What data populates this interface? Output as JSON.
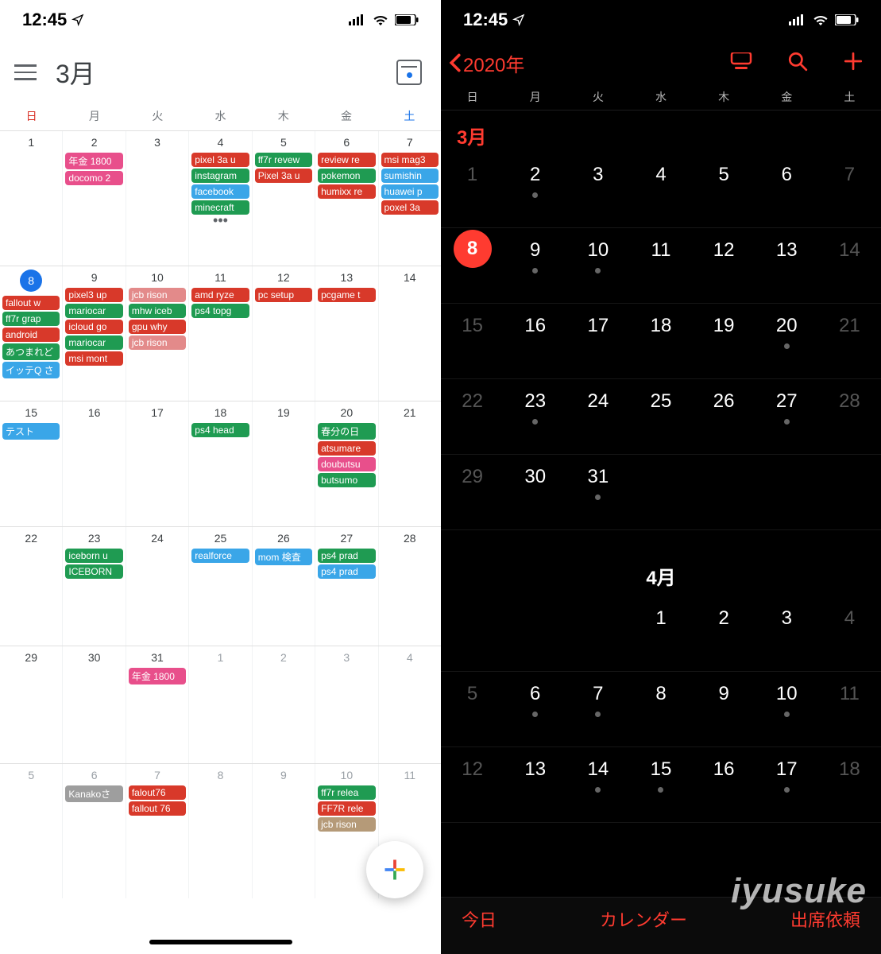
{
  "status": {
    "time": "12:45"
  },
  "google_calendar": {
    "title": "3月",
    "weekdays": [
      "日",
      "月",
      "火",
      "水",
      "木",
      "金",
      "土"
    ],
    "rows": [
      [
        {
          "n": "1",
          "today": false,
          "out": false,
          "events": []
        },
        {
          "n": "2",
          "events": [
            {
              "t": "年金 1800",
              "c": "c-pink"
            },
            {
              "t": "docomo 2",
              "c": "c-pink"
            }
          ]
        },
        {
          "n": "3",
          "events": []
        },
        {
          "n": "4",
          "events": [
            {
              "t": "pixel 3a u",
              "c": "c-red"
            },
            {
              "t": "instagram",
              "c": "c-green"
            },
            {
              "t": "facebook",
              "c": "c-blue"
            },
            {
              "t": "minecraft",
              "c": "c-green"
            }
          ],
          "more": true
        },
        {
          "n": "5",
          "events": [
            {
              "t": "ff7r revew",
              "c": "c-green"
            },
            {
              "t": "Pixel 3a u",
              "c": "c-red"
            }
          ]
        },
        {
          "n": "6",
          "events": [
            {
              "t": "review re",
              "c": "c-red"
            },
            {
              "t": "pokemon",
              "c": "c-green"
            },
            {
              "t": "humixx re",
              "c": "c-red"
            }
          ]
        },
        {
          "n": "7",
          "events": [
            {
              "t": "msi mag3",
              "c": "c-red"
            },
            {
              "t": "sumishin",
              "c": "c-blue"
            },
            {
              "t": "huawei p",
              "c": "c-blue"
            },
            {
              "t": "poxel 3a",
              "c": "c-red"
            }
          ]
        }
      ],
      [
        {
          "n": "8",
          "today": true,
          "events": [
            {
              "t": "fallout w",
              "c": "c-red"
            },
            {
              "t": "ff7r grap",
              "c": "c-green"
            },
            {
              "t": "android",
              "c": "c-red"
            },
            {
              "t": "あつまれど",
              "c": "c-green"
            },
            {
              "t": "イッテQ さ",
              "c": "c-blue"
            }
          ]
        },
        {
          "n": "9",
          "events": [
            {
              "t": "pixel3 up",
              "c": "c-red"
            },
            {
              "t": "mariocar",
              "c": "c-green"
            },
            {
              "t": "icloud go",
              "c": "c-red"
            },
            {
              "t": "mariocar",
              "c": "c-green"
            },
            {
              "t": "msi mont",
              "c": "c-red"
            }
          ]
        },
        {
          "n": "10",
          "events": [
            {
              "t": "jcb rison",
              "c": "c-rose"
            },
            {
              "t": "mhw iceb",
              "c": "c-green"
            },
            {
              "t": "gpu why",
              "c": "c-red"
            },
            {
              "t": "jcb rison",
              "c": "c-rose"
            }
          ]
        },
        {
          "n": "11",
          "events": [
            {
              "t": "amd ryze",
              "c": "c-red"
            },
            {
              "t": "ps4 topg",
              "c": "c-green"
            }
          ]
        },
        {
          "n": "12",
          "events": [
            {
              "t": "pc setup",
              "c": "c-red"
            }
          ]
        },
        {
          "n": "13",
          "events": [
            {
              "t": "pcgame t",
              "c": "c-red"
            }
          ]
        },
        {
          "n": "14",
          "events": []
        }
      ],
      [
        {
          "n": "15",
          "events": [
            {
              "t": "テスト",
              "c": "c-blue"
            }
          ]
        },
        {
          "n": "16",
          "events": []
        },
        {
          "n": "17",
          "events": []
        },
        {
          "n": "18",
          "events": [
            {
              "t": "ps4 head",
              "c": "c-green"
            }
          ]
        },
        {
          "n": "19",
          "events": []
        },
        {
          "n": "20",
          "events": [
            {
              "t": "春分の日",
              "c": "c-green"
            },
            {
              "t": "atsumare",
              "c": "c-red"
            },
            {
              "t": "doubutsu",
              "c": "c-pink"
            },
            {
              "t": "butsumo",
              "c": "c-green"
            }
          ]
        },
        {
          "n": "21",
          "events": []
        }
      ],
      [
        {
          "n": "22",
          "events": []
        },
        {
          "n": "23",
          "events": [
            {
              "t": "iceborn u",
              "c": "c-green"
            },
            {
              "t": "ICEBORN",
              "c": "c-green"
            }
          ]
        },
        {
          "n": "24",
          "events": []
        },
        {
          "n": "25",
          "events": [
            {
              "t": "realforce",
              "c": "c-blue"
            }
          ]
        },
        {
          "n": "26",
          "events": [
            {
              "t": "mom 検査",
              "c": "c-blue"
            }
          ]
        },
        {
          "n": "27",
          "events": [
            {
              "t": "ps4 prad",
              "c": "c-green"
            },
            {
              "t": "ps4 prad",
              "c": "c-blue"
            }
          ]
        },
        {
          "n": "28",
          "events": []
        }
      ],
      [
        {
          "n": "29",
          "events": []
        },
        {
          "n": "30",
          "events": []
        },
        {
          "n": "31",
          "events": [
            {
              "t": "年金 1800",
              "c": "c-pink"
            }
          ]
        },
        {
          "n": "1",
          "out": true,
          "events": []
        },
        {
          "n": "2",
          "out": true,
          "events": []
        },
        {
          "n": "3",
          "out": true,
          "events": []
        },
        {
          "n": "4",
          "out": true,
          "events": []
        }
      ],
      [
        {
          "n": "5",
          "out": true,
          "events": []
        },
        {
          "n": "6",
          "out": true,
          "events": [
            {
              "t": "Kanakoさ",
              "c": "c-grey"
            }
          ]
        },
        {
          "n": "7",
          "out": true,
          "events": [
            {
              "t": "falout76",
              "c": "c-red"
            },
            {
              "t": "fallout 76",
              "c": "c-red"
            }
          ]
        },
        {
          "n": "8",
          "out": true,
          "events": []
        },
        {
          "n": "9",
          "out": true,
          "events": []
        },
        {
          "n": "10",
          "out": true,
          "events": [
            {
              "t": "ff7r relea",
              "c": "c-green"
            },
            {
              "t": "FF7R rele",
              "c": "c-red"
            },
            {
              "t": "jcb rison",
              "c": "c-tan"
            }
          ]
        },
        {
          "n": "11",
          "out": true,
          "events": []
        }
      ]
    ]
  },
  "ios_calendar": {
    "back_label": "2020年",
    "weekdays": [
      "日",
      "月",
      "火",
      "水",
      "木",
      "金",
      "土"
    ],
    "month_mar": "3月",
    "month_apr": "4月",
    "tab_today": "今日",
    "tab_calendars": "カレンダー",
    "tab_inbox": "出席依頼",
    "rows_mar": [
      [
        {
          "n": "1",
          "dim": true
        },
        {
          "n": "2",
          "dot": true
        },
        {
          "n": "3"
        },
        {
          "n": "4"
        },
        {
          "n": "5"
        },
        {
          "n": "6"
        },
        {
          "n": "7",
          "dim": true
        }
      ],
      [
        {
          "n": "8",
          "sel": true
        },
        {
          "n": "9",
          "dot": true
        },
        {
          "n": "10",
          "dot": true
        },
        {
          "n": "11"
        },
        {
          "n": "12"
        },
        {
          "n": "13"
        },
        {
          "n": "14",
          "dim": true
        }
      ],
      [
        {
          "n": "15",
          "dim": true
        },
        {
          "n": "16"
        },
        {
          "n": "17"
        },
        {
          "n": "18"
        },
        {
          "n": "19"
        },
        {
          "n": "20",
          "dot": true
        },
        {
          "n": "21",
          "dim": true
        }
      ],
      [
        {
          "n": "22",
          "dim": true
        },
        {
          "n": "23",
          "dot": true
        },
        {
          "n": "24"
        },
        {
          "n": "25"
        },
        {
          "n": "26"
        },
        {
          "n": "27",
          "dot": true
        },
        {
          "n": "28",
          "dim": true
        }
      ],
      [
        {
          "n": "29",
          "dim": true
        },
        {
          "n": "30"
        },
        {
          "n": "31",
          "dot": true
        },
        {
          "n": "",
          "blank": true
        },
        {
          "n": "",
          "blank": true
        },
        {
          "n": "",
          "blank": true
        },
        {
          "n": "",
          "blank": true
        }
      ]
    ],
    "rows_apr": [
      [
        {
          "n": "",
          "blank": true
        },
        {
          "n": "",
          "blank": true
        },
        {
          "n": "",
          "blank": true
        },
        {
          "n": "1"
        },
        {
          "n": "2"
        },
        {
          "n": "3"
        },
        {
          "n": "4",
          "dim": true
        }
      ],
      [
        {
          "n": "5",
          "dim": true
        },
        {
          "n": "6",
          "dot": true
        },
        {
          "n": "7",
          "dot": true
        },
        {
          "n": "8"
        },
        {
          "n": "9"
        },
        {
          "n": "10",
          "dot": true
        },
        {
          "n": "11",
          "dim": true
        }
      ],
      [
        {
          "n": "12",
          "dim": true
        },
        {
          "n": "13"
        },
        {
          "n": "14",
          "dot": true
        },
        {
          "n": "15",
          "dot": true
        },
        {
          "n": "16"
        },
        {
          "n": "17",
          "dot": true
        },
        {
          "n": "18",
          "dim": true
        }
      ]
    ]
  },
  "watermark": "iyusuke"
}
